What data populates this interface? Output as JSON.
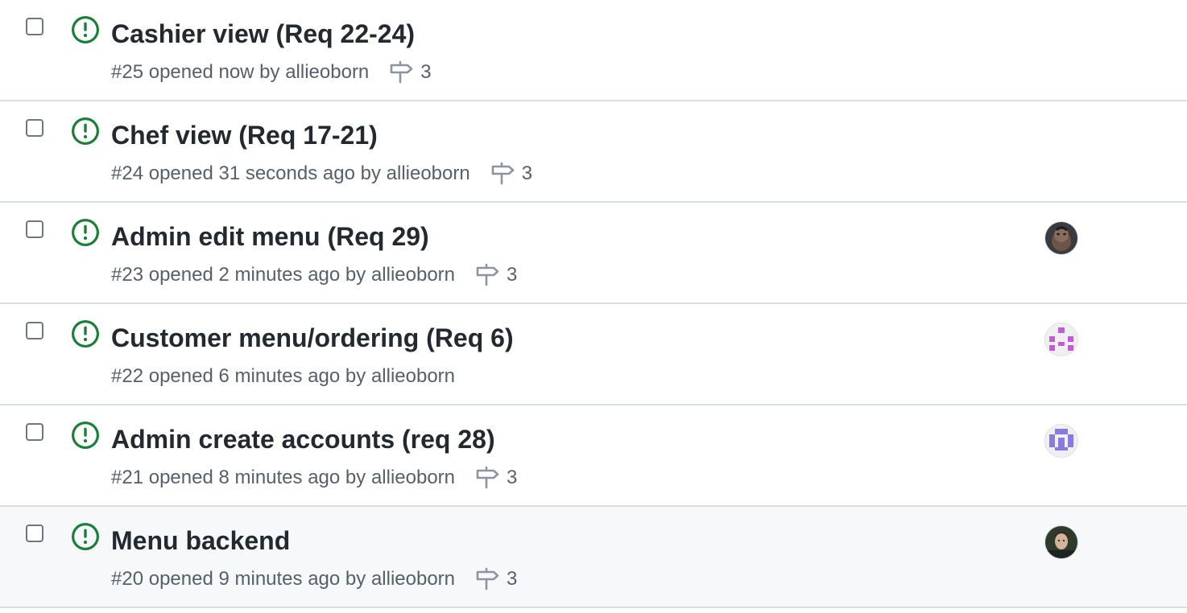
{
  "colors": {
    "open_icon": "#1a7f37",
    "title": "#24292f",
    "meta": "#57606a",
    "divider": "#d8dee4",
    "hover_row_bg": "#f6f8fa"
  },
  "issues": [
    {
      "title": "Cashier view (Req 22-24)",
      "number": "#25",
      "opened": "opened now",
      "by": "by",
      "author": "allieoborn",
      "milestone_count": "3",
      "avatar": "none"
    },
    {
      "title": "Chef view (Req 17-21)",
      "number": "#24",
      "opened": "opened 31 seconds ago",
      "by": "by",
      "author": "allieoborn",
      "milestone_count": "3",
      "avatar": "none"
    },
    {
      "title": "Admin edit menu (Req 29)",
      "number": "#23",
      "opened": "opened 2 minutes ago",
      "by": "by",
      "author": "allieoborn",
      "milestone_count": "3",
      "avatar": "photo-dark"
    },
    {
      "title": "Customer menu/ordering (Req 6)",
      "number": "#22",
      "opened": "opened 6 minutes ago",
      "by": "by",
      "author": "allieoborn",
      "milestone_count": "",
      "avatar": "identicon-magenta"
    },
    {
      "title": "Admin create accounts (req 28)",
      "number": "#21",
      "opened": "opened 8 minutes ago",
      "by": "by",
      "author": "allieoborn",
      "milestone_count": "3",
      "avatar": "identicon-purple"
    },
    {
      "title": "Menu backend",
      "number": "#20",
      "opened": "opened 9 minutes ago",
      "by": "by",
      "author": "allieoborn",
      "milestone_count": "3",
      "avatar": "photo-person"
    }
  ]
}
